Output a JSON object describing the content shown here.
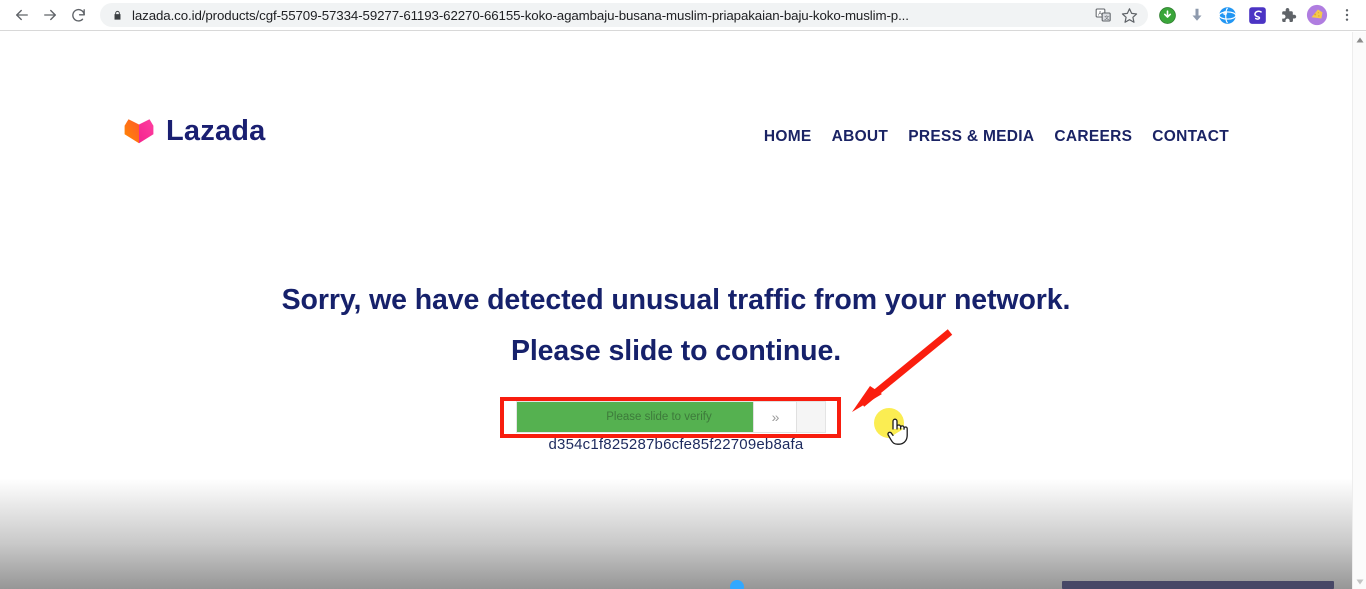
{
  "browser": {
    "back_icon": "back-arrow-icon",
    "forward_icon": "forward-arrow-icon",
    "reload_icon": "reload-icon",
    "lock_icon": "lock-icon",
    "url": "lazada.co.id/products/cgf-55709-57334-59277-61193-62270-66155-koko-agambaju-busana-muslim-priapakaian-baju-koko-muslim-p...",
    "translate_icon": "translate-icon",
    "bookmark_icon": "star-icon",
    "extensions": [
      {
        "name": "download-manager-icon"
      },
      {
        "name": "download-arrow-icon"
      },
      {
        "name": "globe-browser-icon"
      },
      {
        "name": "script-extension-icon"
      },
      {
        "name": "puzzle-extensions-icon"
      },
      {
        "name": "profile-avatar-icon"
      },
      {
        "name": "chrome-menu-icon"
      }
    ]
  },
  "site": {
    "logo": {
      "text": "Lazada",
      "mark": "lazada-heart-icon",
      "color_start": "#ff7a00",
      "color_end": "#f3248e",
      "text_color": "#1a1f71"
    },
    "nav": [
      {
        "label": "HOME"
      },
      {
        "label": "ABOUT"
      },
      {
        "label": "PRESS & MEDIA"
      },
      {
        "label": "CAREERS"
      },
      {
        "label": "CONTACT"
      }
    ]
  },
  "main": {
    "headline_line1": "Sorry, we have detected unusual traffic from your network.",
    "headline_line2": "Please slide to continue.",
    "headline_color": "#16216b",
    "captcha": {
      "slider_label": "Please slide to verify",
      "handle_glyph": "»",
      "fill_color": "#55b150",
      "track_color": "#f5f5f5",
      "highlight_box_color": "#f81d0e"
    },
    "hash": "d354c1f825287b6cfe85f22709eb8afa",
    "annotation": {
      "arrow": "red-arrow-annotation",
      "arrow_color": "#fa1e0e"
    },
    "cursor": {
      "highlight": "yellow-click-highlight",
      "highlight_color": "#fbed52",
      "pointer": "hand-pointer-cursor"
    }
  },
  "scrollbar": {
    "up_arrow": "scroll-up-arrow-icon",
    "down_arrow": "scroll-down-arrow-icon"
  }
}
